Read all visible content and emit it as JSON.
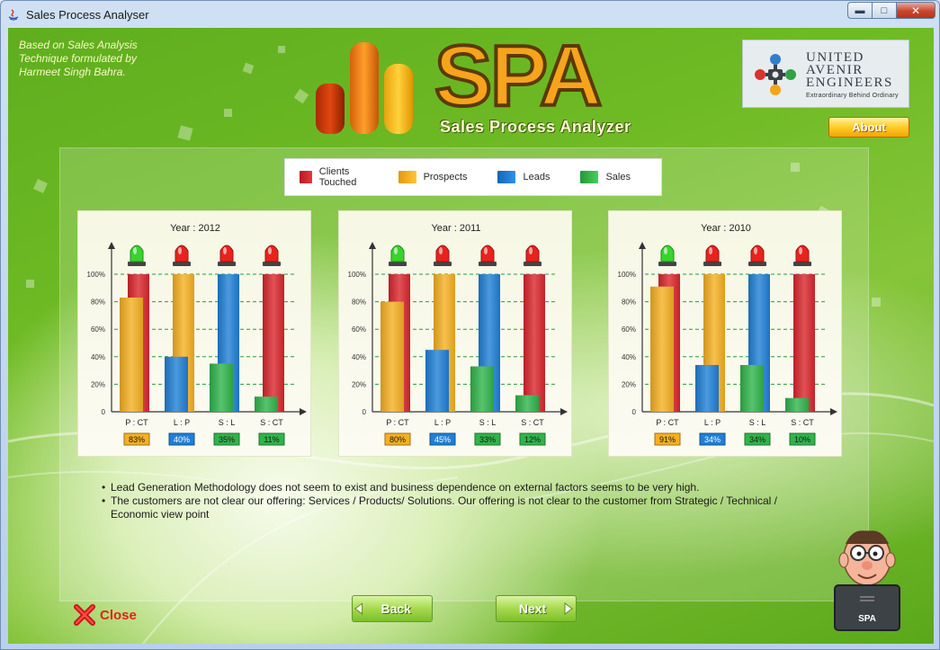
{
  "window": {
    "title": "Sales Process Analyser"
  },
  "header": {
    "credit": "Based on Sales Analysis Technique formulated by Harmeet Singh Bahra.",
    "logo_text": "SPA",
    "logo_subtitle": "Sales Process Analyzer",
    "company_line1": "UNITED",
    "company_line2": "AVENIR",
    "company_line3": "ENGINEERS",
    "company_tagline": "Extraordinary Behind Ordinary",
    "about_label": "About"
  },
  "legend": [
    {
      "label": "Clients Touched",
      "color": "#d9262c"
    },
    {
      "label": "Prospects",
      "color": "#f5b021"
    },
    {
      "label": "Leads",
      "color": "#1f7fd6"
    },
    {
      "label": "Sales",
      "color": "#2fb44a"
    }
  ],
  "chart_data": [
    {
      "type": "bar",
      "title": "Year : 2012",
      "categories": [
        "P : CT",
        "L : P",
        "S : L",
        "S : CT"
      ],
      "bases": [
        {
          "name": "Clients Touched",
          "value": 100
        },
        {
          "name": "Prospects",
          "value": 100
        },
        {
          "name": "Leads",
          "value": 100
        },
        {
          "name": "Clients Touched",
          "value": 100
        }
      ],
      "values": [
        {
          "name": "Prospects",
          "value": 83
        },
        {
          "name": "Leads",
          "value": 40
        },
        {
          "name": "Sales",
          "value": 35
        },
        {
          "name": "Sales",
          "value": 11
        }
      ],
      "value_labels": [
        "83%",
        "40%",
        "35%",
        "11%"
      ],
      "status_lights": [
        "green",
        "red",
        "red",
        "red"
      ],
      "yticks": [
        "0",
        "20%",
        "40%",
        "60%",
        "80%",
        "100%"
      ],
      "ylim": [
        0,
        100
      ]
    },
    {
      "type": "bar",
      "title": "Year : 2011",
      "categories": [
        "P : CT",
        "L : P",
        "S : L",
        "S : CT"
      ],
      "bases": [
        {
          "name": "Clients Touched",
          "value": 100
        },
        {
          "name": "Prospects",
          "value": 100
        },
        {
          "name": "Leads",
          "value": 100
        },
        {
          "name": "Clients Touched",
          "value": 100
        }
      ],
      "values": [
        {
          "name": "Prospects",
          "value": 80
        },
        {
          "name": "Leads",
          "value": 45
        },
        {
          "name": "Sales",
          "value": 33
        },
        {
          "name": "Sales",
          "value": 12
        }
      ],
      "value_labels": [
        "80%",
        "45%",
        "33%",
        "12%"
      ],
      "status_lights": [
        "green",
        "red",
        "red",
        "red"
      ],
      "yticks": [
        "0",
        "20%",
        "40%",
        "60%",
        "80%",
        "100%"
      ],
      "ylim": [
        0,
        100
      ]
    },
    {
      "type": "bar",
      "title": "Year : 2010",
      "categories": [
        "P : CT",
        "L : P",
        "S : L",
        "S : CT"
      ],
      "bases": [
        {
          "name": "Clients Touched",
          "value": 100
        },
        {
          "name": "Prospects",
          "value": 100
        },
        {
          "name": "Leads",
          "value": 100
        },
        {
          "name": "Clients Touched",
          "value": 100
        }
      ],
      "values": [
        {
          "name": "Prospects",
          "value": 91
        },
        {
          "name": "Leads",
          "value": 34
        },
        {
          "name": "Sales",
          "value": 34
        },
        {
          "name": "Sales",
          "value": 10
        }
      ],
      "value_labels": [
        "91%",
        "34%",
        "34%",
        "10%"
      ],
      "status_lights": [
        "green",
        "red",
        "red",
        "red"
      ],
      "yticks": [
        "0",
        "20%",
        "40%",
        "60%",
        "80%",
        "100%"
      ],
      "ylim": [
        0,
        100
      ]
    }
  ],
  "observations": [
    "Lead Generation Methodology does not seem to exist and business dependence on external factors seems to be very high.",
    "The customers are not clear our offering: Services / Products/ Solutions. Our offering is not clear to the customer from Strategic / Technical / Economic view point"
  ],
  "footer": {
    "close_label": "Close",
    "back_label": "Back",
    "next_label": "Next",
    "mascot_label": "SPA"
  },
  "colors": {
    "red": "#d9262c",
    "yellow": "#f5b021",
    "blue": "#1f7fd6",
    "green": "#2fb44a",
    "label_yellow": "#f5b021",
    "label_blue": "#1f7fd6",
    "label_green": "#2fb44a"
  }
}
